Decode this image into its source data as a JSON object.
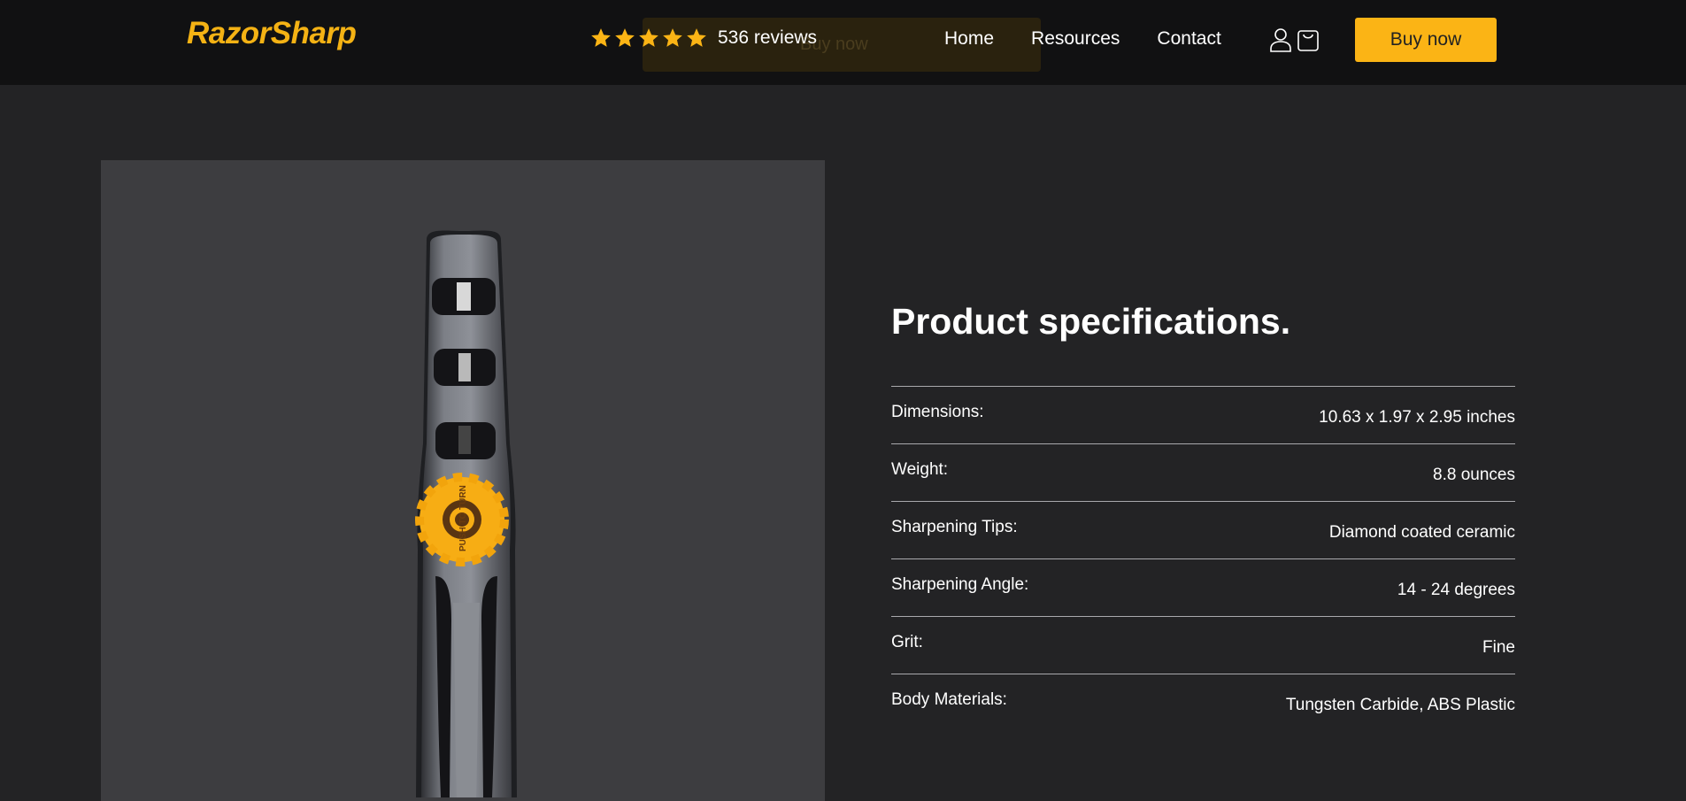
{
  "header": {
    "logo": "RazorSharp",
    "ghost_button_label": "Buy now",
    "rating": {
      "stars": 5,
      "reviews_label": "536 reviews"
    },
    "nav": [
      {
        "label": "Home"
      },
      {
        "label": "Resources"
      },
      {
        "label": "Contact"
      }
    ],
    "icons": [
      "user-icon",
      "cart-icon"
    ],
    "buy_button_label": "Buy now",
    "accent_color": "#fbb415"
  },
  "product": {
    "image_alt_subject": "knife-sharpener",
    "dial_text": "PUSH TO TURN"
  },
  "specs": {
    "title": "Product specifications.",
    "rows": [
      {
        "label": "Dimensions:",
        "value": "10.63 x 1.97 x 2.95 inches"
      },
      {
        "label": "Weight:",
        "value": "8.8 ounces"
      },
      {
        "label": "Sharpening Tips:",
        "value": "Diamond coated ceramic"
      },
      {
        "label": "Sharpening Angle:",
        "value": "14 - 24 degrees"
      },
      {
        "label": "Grit:",
        "value": "Fine"
      },
      {
        "label": "Body Materials:",
        "value": "Tungsten Carbide, ABS Plastic"
      }
    ]
  }
}
